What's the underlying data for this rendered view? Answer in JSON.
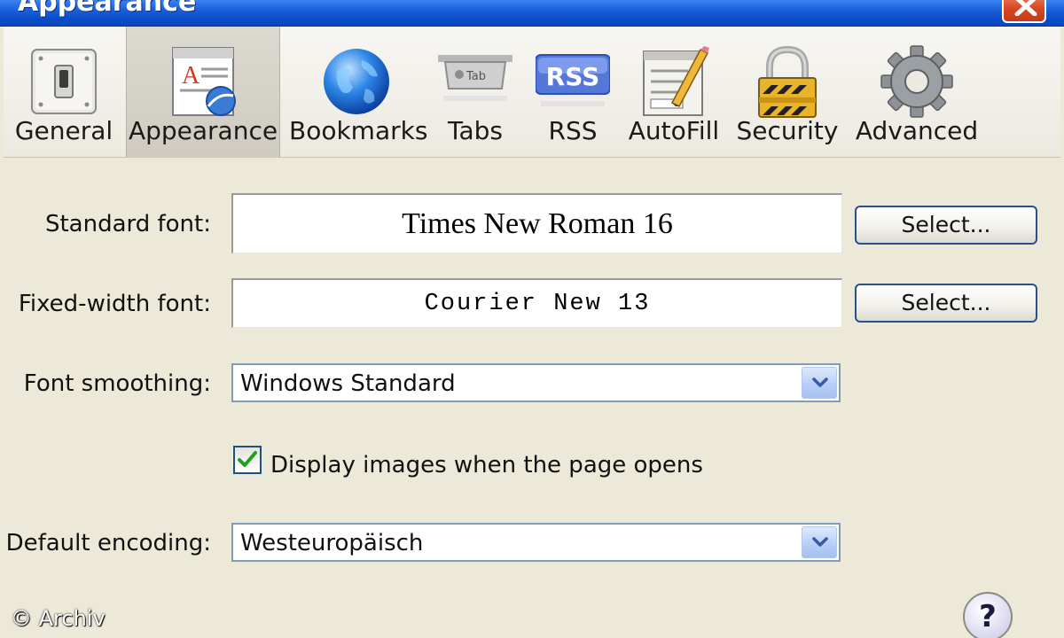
{
  "window": {
    "title": "Appearance",
    "close_icon": "close-icon"
  },
  "toolbar": {
    "items": [
      {
        "label": "General",
        "icon": "switch-icon",
        "selected": false
      },
      {
        "label": "Appearance",
        "icon": "appearance-icon",
        "selected": true
      },
      {
        "label": "Bookmarks",
        "icon": "globe-icon",
        "selected": false
      },
      {
        "label": "Tabs",
        "icon": "tab-icon",
        "selected": false,
        "icon_text": "Tab"
      },
      {
        "label": "RSS",
        "icon": "rss-icon",
        "selected": false,
        "icon_text": "RSS"
      },
      {
        "label": "AutoFill",
        "icon": "autofill-icon",
        "selected": false
      },
      {
        "label": "Security",
        "icon": "lock-icon",
        "selected": false
      },
      {
        "label": "Advanced",
        "icon": "gear-icon",
        "selected": false
      }
    ]
  },
  "form": {
    "standard_font": {
      "label": "Standard font:",
      "value": "Times New Roman 16",
      "button": "Select..."
    },
    "fixed_font": {
      "label": "Fixed-width font:",
      "value": "Courier New 13",
      "button": "Select..."
    },
    "font_smoothing": {
      "label": "Font smoothing:",
      "value": "Windows Standard"
    },
    "display_images": {
      "label": "Display images when the page opens",
      "checked": true
    },
    "default_encoding": {
      "label": "Default encoding:",
      "value": "Westeuropäisch"
    }
  },
  "help": {
    "label": "?"
  },
  "watermark": "© Archiv",
  "colors": {
    "titlebar": "#0a4bc8",
    "background": "#ece9d8",
    "checkmark": "#21a121",
    "button_border": "#2b4f8c"
  }
}
